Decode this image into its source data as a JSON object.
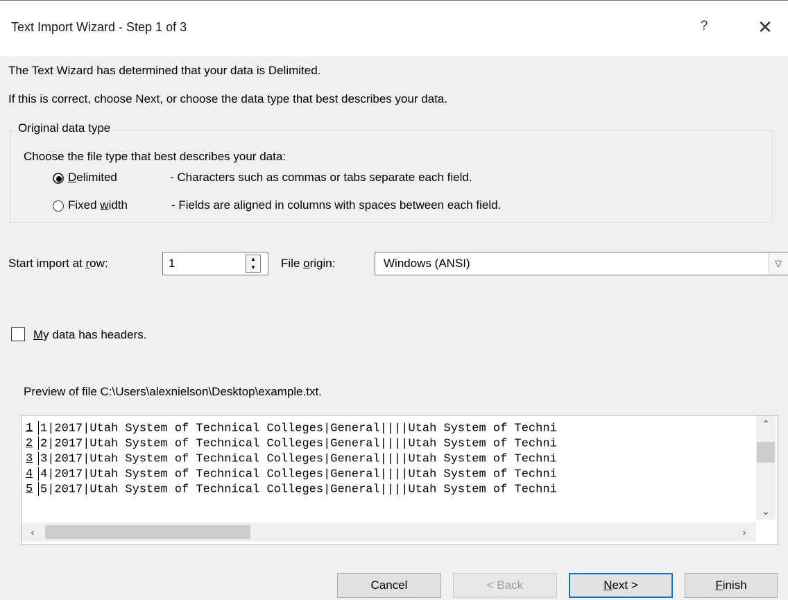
{
  "window": {
    "title": "Text Import Wizard - Step 1 of 3",
    "help_glyph": "?",
    "close_glyph": "✕"
  },
  "intro": {
    "line1": "The Text Wizard has determined that your data is Delimited.",
    "line2": "If this is correct, choose Next, or choose the data type that best describes your data."
  },
  "original_data_type": {
    "legend": "Original data type",
    "prompt": "Choose the file type that best describes your data:",
    "options": [
      {
        "label": "Delimited",
        "accel": "D",
        "label_rest": "elimited",
        "description": "- Characters such as commas or tabs separate each field.",
        "selected": true
      },
      {
        "label": "Fixed width",
        "label_pre": "Fixed ",
        "accel": "w",
        "label_rest": "idth",
        "description": "- Fields are aligned in columns with spaces between each field.",
        "selected": false
      }
    ]
  },
  "start_row": {
    "label_pre": "Start import at ",
    "accel": "r",
    "label_rest": "ow:",
    "value": "1"
  },
  "file_origin": {
    "label_pre": "File ",
    "accel": "o",
    "label_rest": "rigin:",
    "value": "Windows (ANSI)"
  },
  "headers_checkbox": {
    "accel": "M",
    "label_rest": "y data has headers.",
    "checked": false
  },
  "preview": {
    "label": "Preview of file C:\\Users\\alexnielson\\Desktop\\example.txt.",
    "rows": [
      {
        "num": "1",
        "text": "1|2017|Utah System of Technical Colleges|General||||Utah System of Techni"
      },
      {
        "num": "2",
        "text": "2|2017|Utah System of Technical Colleges|General||||Utah System of Techni"
      },
      {
        "num": "3",
        "text": "3|2017|Utah System of Technical Colleges|General||||Utah System of Techni"
      },
      {
        "num": "4",
        "text": "4|2017|Utah System of Technical Colleges|General||||Utah System of Techni"
      },
      {
        "num": "5",
        "text": "5|2017|Utah System of Technical Colleges|General||||Utah System of Techni"
      }
    ]
  },
  "buttons": {
    "cancel": "Cancel",
    "back": "< Back",
    "next_accel": "N",
    "next_rest": "ext >",
    "finish_accel": "F",
    "finish_rest": "inish"
  },
  "colors": {
    "dialog_bg": "#f0f0f0",
    "default_button_border": "#0078d7",
    "disabled_text": "#a0a0a0"
  }
}
